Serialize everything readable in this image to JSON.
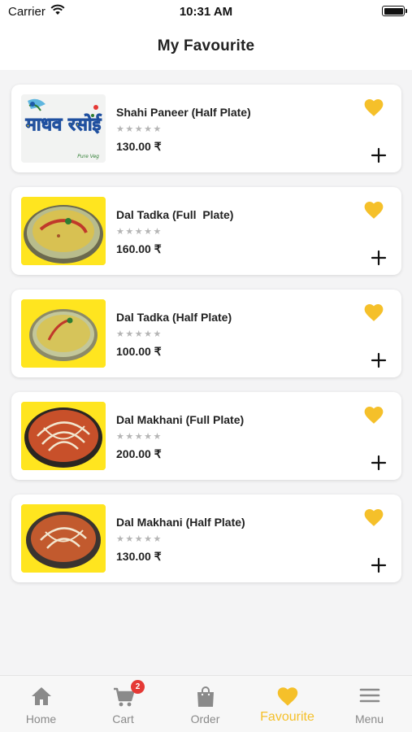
{
  "status_bar": {
    "carrier": "Carrier",
    "time": "10:31 AM"
  },
  "header": {
    "title": "My Favourite"
  },
  "colors": {
    "accent": "#f5c02a",
    "badge": "#e53935",
    "inactive": "#8a8a8a"
  },
  "favourites": [
    {
      "name": "Shahi Paneer (Half Plate)",
      "rating": 0,
      "stars": "★★★★★",
      "price": "130.00 ₹",
      "image": "madhav-rasoi-logo",
      "logo_text": "माधव रसोई",
      "logo_tag": "Pure Veg"
    },
    {
      "name": "Dal Tadka (Full  Plate)",
      "rating": 0,
      "stars": "★★★★★",
      "price": "160.00 ₹",
      "image": "dal-tadka-bowl"
    },
    {
      "name": "Dal Tadka (Half Plate)",
      "rating": 0,
      "stars": "★★★★★",
      "price": "100.00 ₹",
      "image": "dal-tadka-bowl"
    },
    {
      "name": "Dal Makhani (Full Plate)",
      "rating": 0,
      "stars": "★★★★★",
      "price": "200.00 ₹",
      "image": "dal-makhani-bowl"
    },
    {
      "name": "Dal Makhani (Half Plate)",
      "rating": 0,
      "stars": "★★★★★",
      "price": "130.00 ₹",
      "image": "dal-makhani-bowl"
    }
  ],
  "tab_bar": {
    "tabs": [
      {
        "label": "Home",
        "icon": "home-icon"
      },
      {
        "label": "Cart",
        "icon": "cart-icon",
        "badge": "2"
      },
      {
        "label": "Order",
        "icon": "bag-icon"
      },
      {
        "label": "Favourite",
        "icon": "heart-icon",
        "active": true
      },
      {
        "label": "Menu",
        "icon": "menu-icon"
      }
    ]
  }
}
